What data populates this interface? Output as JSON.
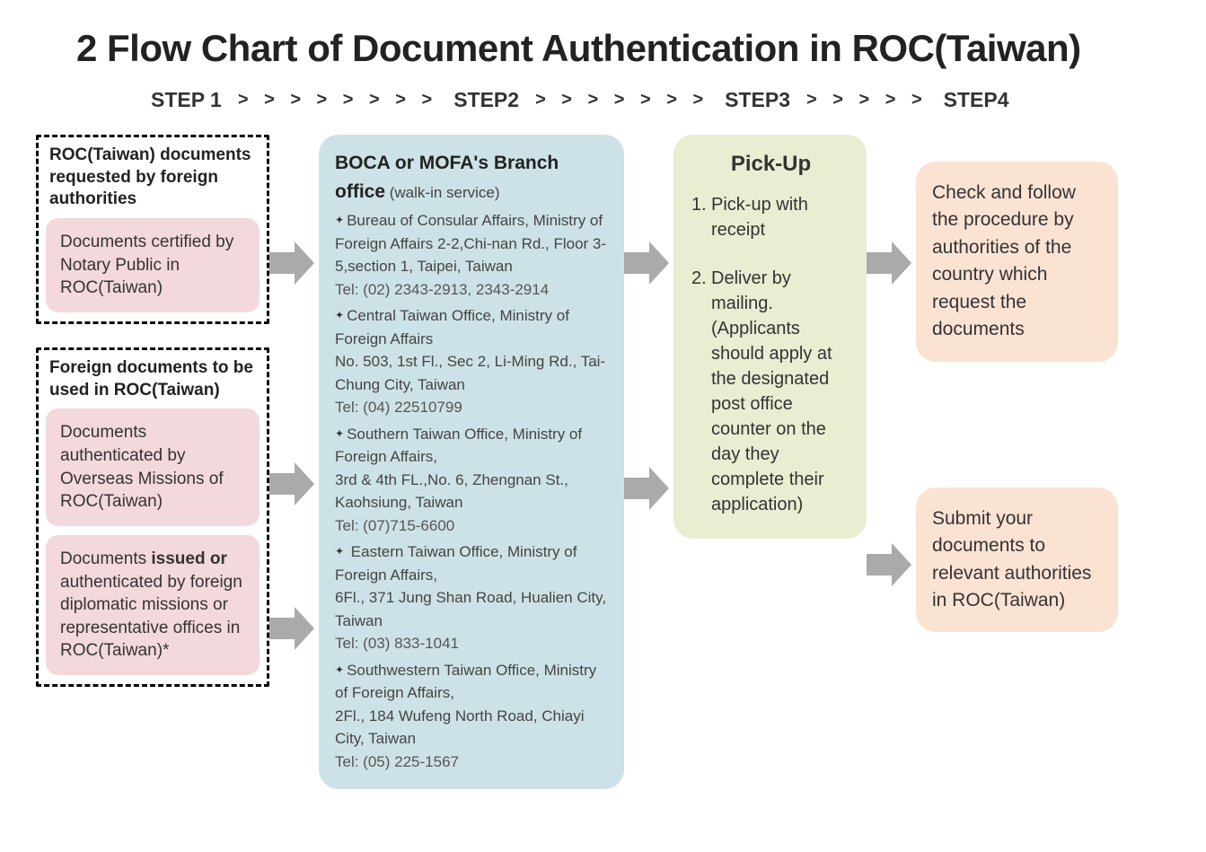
{
  "title": "2 Flow Chart of Document Authentication in ROC(Taiwan)",
  "steps": {
    "s1": "STEP 1",
    "s2": "STEP2",
    "s3": "STEP3",
    "s4": "STEP4",
    "chev1": "> > > > > > > >",
    "chev2": "> > > > > > >",
    "chev3": "> > > > >"
  },
  "col1": {
    "groupA": {
      "header": "ROC(Taiwan) documents requested by foreign authorities",
      "box1": "Documents certified by Notary Public in ROC(Taiwan)"
    },
    "groupB": {
      "header": "Foreign documents to be used in ROC(Taiwan)",
      "box1": "Documents authenticated by Overseas Missions of ROC(Taiwan)",
      "box2_pre": "Documents ",
      "box2_bold": "issued or",
      "box2_post": " authenticated by foreign diplomatic missions or representative offices in ROC(Taiwan)*"
    }
  },
  "col2": {
    "title": "BOCA or MOFA's Branch office",
    "subtitle": " (walk-in service)",
    "offices": [
      {
        "name": "Bureau of Consular Affairs, Ministry of Foreign Affairs 2-2,Chi-nan Rd., Floor 3-5,section 1, Taipei, Taiwan",
        "tel": "Tel: (02) 2343-2913, 2343-2914"
      },
      {
        "name": "Central Taiwan Office, Ministry of Foreign Affairs",
        "addr": "No. 503, 1st Fl., Sec 2, Li-Ming Rd., Tai-Chung City, Taiwan",
        "tel": "Tel: (04) 22510799"
      },
      {
        "name": "Southern Taiwan Office, Ministry of Foreign Affairs,",
        "addr": "3rd & 4th FL.,No. 6, Zhengnan St., Kaohsiung, Taiwan",
        "tel": "Tel: (07)715-6600"
      },
      {
        "name": " Eastern Taiwan Office, Ministry of Foreign Affairs,",
        "addr": "6Fl., 371 Jung Shan Road, Hualien City, Taiwan",
        "tel": "Tel: (03) 833-1041"
      },
      {
        "name": "Southwestern Taiwan Office, Ministry of Foreign Affairs,",
        "addr": "2Fl., 184 Wufeng North Road, Chiayi City, Taiwan",
        "tel": "Tel: (05) 225-1567"
      }
    ]
  },
  "col3": {
    "title": "Pick-Up",
    "item1": "Pick-up with receipt",
    "item2": "Deliver by mailing. (Applicants should apply at the designated post office counter on the day they complete their application)"
  },
  "col4": {
    "top": "Check and follow the procedure by authorities of the country which request the documents",
    "bottom": "Submit your documents to relevant authorities in ROC(Taiwan)"
  }
}
